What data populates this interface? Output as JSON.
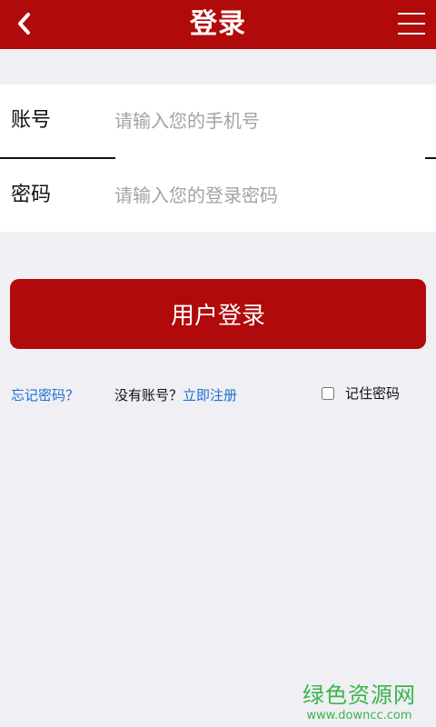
{
  "header": {
    "title": "登录"
  },
  "form": {
    "account_label": "账号",
    "account_placeholder": "请输入您的手机号",
    "password_label": "密码",
    "password_placeholder": "请输入您的登录密码"
  },
  "login_button_label": "用户登录",
  "links": {
    "forgot_password": "忘记密码？",
    "no_account": "没有账号？",
    "register": "立即注册",
    "remember_password": "记住密码",
    "remember_checked": false
  },
  "watermark": {
    "name": "绿色资源网",
    "url": "www.downcc.com"
  },
  "colors": {
    "brand": "#b00a0a",
    "link": "#1c6fd0",
    "background": "#efeff4"
  }
}
